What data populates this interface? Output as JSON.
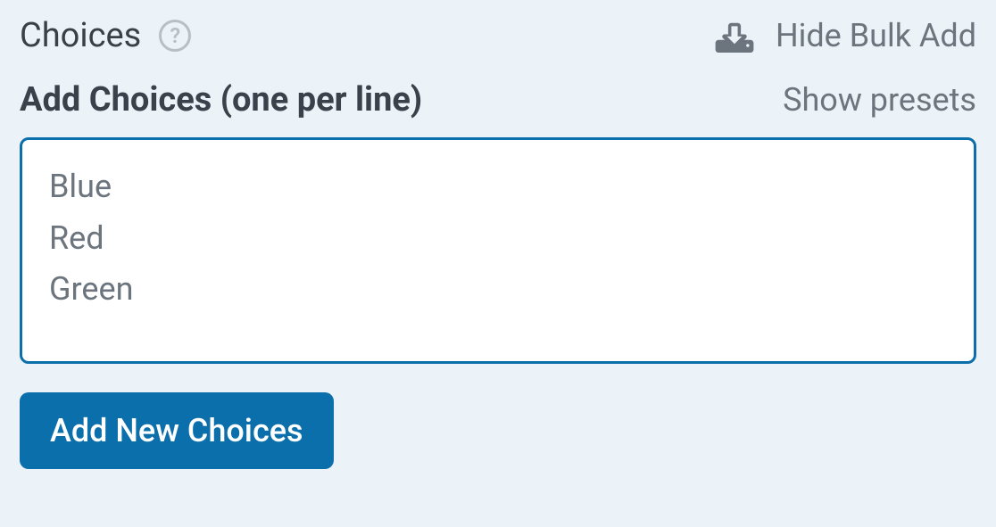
{
  "header": {
    "title": "Choices",
    "help_symbol": "?",
    "hide_bulk_label": "Hide Bulk Add"
  },
  "sub": {
    "add_choices_label": "Add Choices (one per line)",
    "show_presets_label": "Show presets"
  },
  "textarea": {
    "value": "Blue\nRed\nGreen"
  },
  "actions": {
    "add_button_label": "Add New Choices"
  }
}
